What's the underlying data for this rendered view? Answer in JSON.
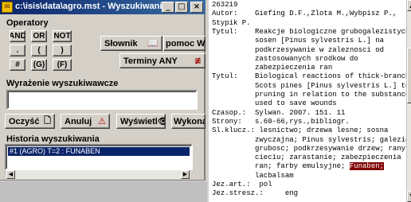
{
  "window": {
    "title": "c:\\isis\\data\\agro.mst - Wyszukiwanie",
    "minimize": "_",
    "maximize": "□",
    "close": "×"
  },
  "operators": {
    "label": "Operatory",
    "buttons": [
      "AND",
      "OR",
      "NOT",
      ".",
      "(",
      ")",
      "#",
      "(G)",
      "(F)"
    ]
  },
  "buttons": {
    "slownik": "Słownik",
    "pomoc": "pomoc Win",
    "terminy": "Terminy ANY",
    "clear": "Oczyść",
    "cancel": "Anuluj",
    "show": "Wyświetl",
    "run": "Wykonaj"
  },
  "expression": {
    "label": "Wyrażenie wyszukiwawcze",
    "value": ""
  },
  "history": {
    "label": "Historia wyszukiwania",
    "items": [
      "#1 (AGRO) T=2 : FUNABEN"
    ]
  },
  "record": {
    "lines": [
      {
        "text": "263219"
      },
      {
        "text": "Autor:    Giefing D.F.,Zlota M.,Wybpisz P.,"
      },
      {
        "text": "Stypik P."
      },
      {
        "text": "Tytul:    Reakcje biologiczne grubogalezistych"
      },
      {
        "text": "          sosen [Pinus sylvestris L.] na"
      },
      {
        "text": "          podkrzesywanie w zaleznosci od"
      },
      {
        "text": "          zastosowanych srodkow do"
      },
      {
        "text": "          zabezpieczenia ran"
      },
      {
        "text": "Tytul:    Biological reactions of thick-branched"
      },
      {
        "text": "          Scots pines [Pinus sylvestris L.] to"
      },
      {
        "text": "          pruning in relation to the substance"
      },
      {
        "text": "          used to save wounds"
      },
      {
        "text": "Czasop.:  Sylwan. 2007. 151. 11"
      },
      {
        "text": "Strony:   s.60-66,rys.,bibliogr."
      },
      {
        "text": "Sl.klucz.: lesnictwo; drzewa lesne; sosna"
      },
      {
        "text": "          zwyczajna; Pinus sylvestris; galezie;"
      },
      {
        "text": "          grubosc; podkrzesywanie drzew; rany po"
      },
      {
        "text": "          cieciu; zarastanie; zabezpieczenia"
      },
      {
        "text": "          ran; farby emulsyjne; ",
        "highlight": "Funaben;"
      },
      {
        "text": "          lacbalsam"
      },
      {
        "text": "Jez.art.:  pol"
      },
      {
        "text": "Jez.stresz.:     eng"
      }
    ]
  },
  "colors": {
    "titlebar": "#0a246a",
    "selection": "#0a246a",
    "highlight": "#800000",
    "face": "#d4d0c8"
  }
}
